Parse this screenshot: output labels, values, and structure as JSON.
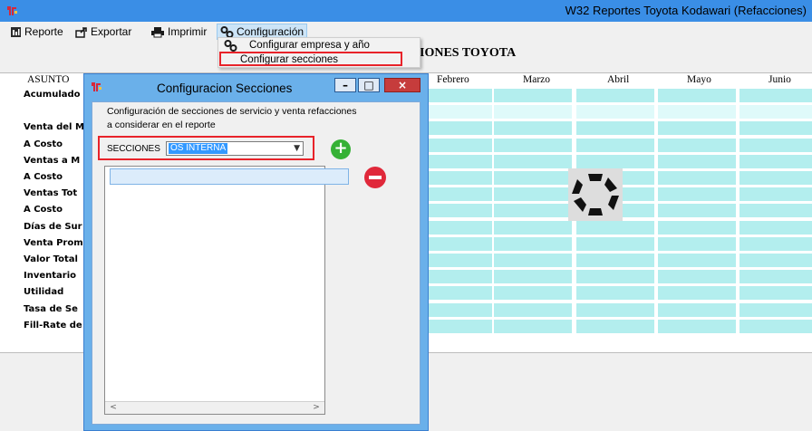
{
  "window": {
    "title": "W32 Reportes Toyota Kodawari (Refacciones)"
  },
  "menu": {
    "items": [
      {
        "label": "Reporte",
        "icon": "report-icon"
      },
      {
        "label": "Exportar",
        "icon": "export-icon"
      },
      {
        "label": "Imprimir",
        "icon": "printer-icon"
      },
      {
        "label": "Configuración",
        "icon": "gears-icon"
      }
    ],
    "dropdown": [
      {
        "label": "Configurar empresa y año",
        "icon": "gears-icon"
      },
      {
        "label": "Configurar secciones",
        "icon": ""
      }
    ]
  },
  "report": {
    "title_fragment": "IONES TOYOTA"
  },
  "grid": {
    "headers": [
      "ASUNTO",
      "Febrero",
      "Marzo",
      "Abril",
      "Mayo",
      "Junio"
    ],
    "rows": [
      "Acumulado",
      "",
      "Venta del M",
      "A Costo",
      "Ventas a M",
      "A Costo",
      "Ventas Tot",
      "A Costo",
      "Días de Sur",
      "Venta Prom",
      "Valor Total",
      "Inventario",
      "Utilidad",
      "Tasa de Se",
      "Fill-Rate de"
    ]
  },
  "dialog": {
    "title": "Configuracion Secciones",
    "description_line1": "Configuración de secciones de servicio y venta refacciones",
    "description_line2": "a considerar en el reporte",
    "secciones_label": "SECCIONES",
    "secciones_value": "OS INTERNA",
    "buttons": {
      "minimize": "–",
      "maximize": "□",
      "close": "×"
    }
  },
  "colors": {
    "titlebar": "#3a8ee6",
    "dialog_frame": "#6ab0ea",
    "cell": "#b3eeee",
    "highlight": "#e8232a",
    "add": "#35b135",
    "remove": "#e0283a"
  }
}
